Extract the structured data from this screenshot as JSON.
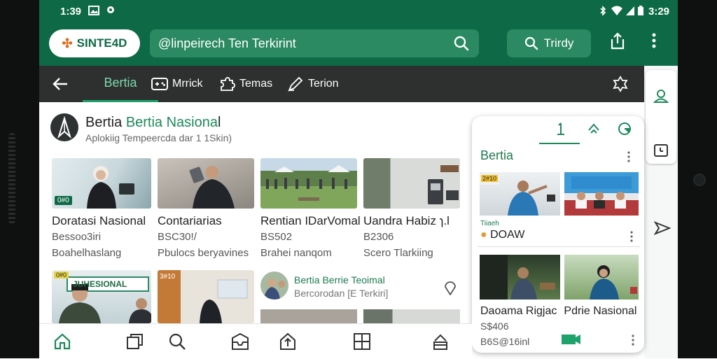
{
  "status_bar": {
    "time_left": "1:39",
    "time_right": "3:29"
  },
  "app_bar": {
    "logo_text": "SINTE4D",
    "search_text": "@linpeirech Ten Terkirint",
    "trending_label": "Trirdy"
  },
  "tabs": [
    {
      "label": "Bertia",
      "icon": "none",
      "active": true
    },
    {
      "label": "Mrrick",
      "icon": "gamepad-icon",
      "active": false
    },
    {
      "label": "Temas",
      "icon": "puzzle-icon",
      "active": false
    },
    {
      "label": "Terion",
      "icon": "pen-icon",
      "active": false
    }
  ],
  "feed": {
    "title_part1": "Bertia ",
    "title_part2": "Bertia Nasiona",
    "title_part3": "l",
    "subtitle": "Aplokiig Tempeercda dar 1 1Skin)"
  },
  "cards_row1": [
    {
      "title": "Doratasi Nasional",
      "line1": "Bessoo3iri",
      "line2": "Boahelhaslang",
      "badge": "0#0"
    },
    {
      "title": "Contariarias",
      "line1": "BSC30!/",
      "line2": "Pbulocs beryavines",
      "badge": ""
    },
    {
      "title": "Rentian IDarVomal",
      "line1": "BS502",
      "line2": "Brahei nanqom",
      "badge": ""
    },
    {
      "title": "Uandra Habiz",
      "line1": "B2306",
      "line2": "Scero Tlarkiing",
      "badge": "",
      "suffix": "ɿ.l"
    }
  ],
  "cards_row2": [
    {
      "badge": "0#0",
      "banner": "JUHESIONAL"
    },
    {
      "badge": "3#10"
    }
  ],
  "inline_item": {
    "title": "Bertia Berrie Teoimal",
    "subtitle": "Bercorodan [E Terkiri]"
  },
  "panel": {
    "title": "Bertia",
    "item1_title": "DOAW",
    "item1_tag": "Tiiaeh",
    "item1_badge": "2#10",
    "item2_title_a": "Daoama Rigjac",
    "item2_title_b": "Pdrie Nasional",
    "item2_line1": "S$406",
    "item2_line2": "B6S@16inl"
  },
  "colors": {
    "primary": "#0e6a46",
    "accent": "#1ea36c",
    "tabbar": "#2e3030",
    "search_bg": "#2b8a62"
  }
}
